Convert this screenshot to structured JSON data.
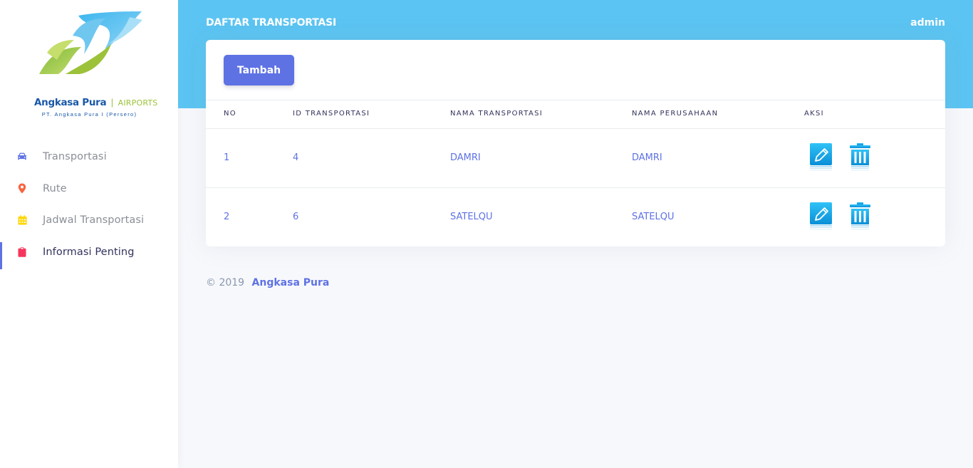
{
  "brand": {
    "name": "Angkasa Pura",
    "separator": "|",
    "suffix": "AIRPORTS",
    "subtitle": "PT. Angkasa Pura I (Persero)"
  },
  "sidebar": {
    "items": [
      {
        "label": "Transportasi",
        "icon": "car-icon",
        "color": "#5e72e4"
      },
      {
        "label": "Rute",
        "icon": "map-pin-icon",
        "color": "#fb6340"
      },
      {
        "label": "Jadwal Transportasi",
        "icon": "calendar-icon",
        "color": "#ffd600"
      },
      {
        "label": "Informasi Penting",
        "icon": "clipboard-icon",
        "color": "#f5365c",
        "active": true
      }
    ]
  },
  "header": {
    "title": "DAFTAR TRANSPORTASI",
    "user": "admin"
  },
  "toolbar": {
    "add_label": "Tambah"
  },
  "table": {
    "columns": [
      "NO",
      "ID TRANSPORTASI",
      "NAMA TRANSPORTASI",
      "NAMA PERUSAHAAN",
      "AKSI"
    ],
    "rows": [
      {
        "no": "1",
        "id": "4",
        "nama": "DAMRI",
        "perusahaan": "DAMRI"
      },
      {
        "no": "2",
        "id": "6",
        "nama": "SATELQU",
        "perusahaan": "SATELQU"
      }
    ],
    "actions": {
      "edit_icon": "edit-icon",
      "delete_icon": "trash-icon"
    }
  },
  "footer": {
    "copyright": "© 2019",
    "link": "Angkasa Pura"
  },
  "colors": {
    "header": "#5bc4f2",
    "primary": "#5e72e4",
    "background": "#f7f8fc"
  }
}
